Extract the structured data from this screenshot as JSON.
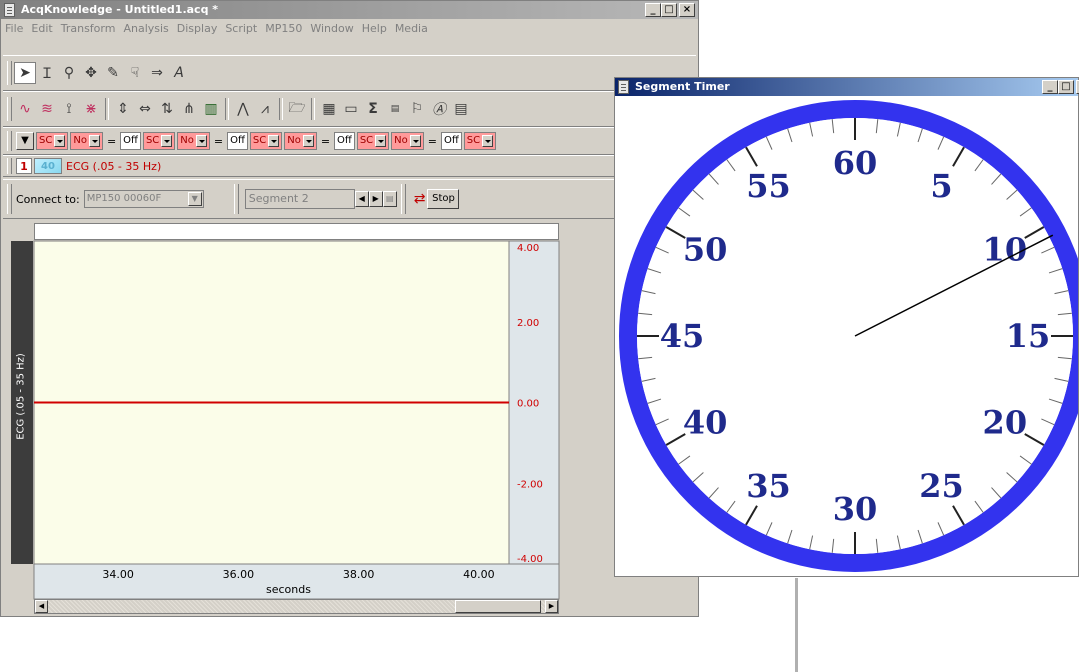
{
  "main_window": {
    "title": "AcqKnowledge - Untitled1.acq *",
    "menu": [
      "File",
      "Edit",
      "Transform",
      "Analysis",
      "Display",
      "Script",
      "MP150",
      "Window",
      "Help",
      "Media"
    ],
    "channel_number": "1",
    "channel_badge": "40",
    "channel_name": "ECG (.05 - 35 Hz)",
    "connect_label": "Connect to:",
    "connect_value": "MP150 00060F",
    "segment_value": "Segment 2",
    "stop_label": "Stop",
    "channel_row": [
      "SC",
      "No",
      "=",
      "Off",
      "SC",
      "No",
      "=",
      "Off",
      "SC",
      "No",
      "=",
      "Off",
      "SC",
      "No",
      "=",
      "Off",
      "SC"
    ],
    "y_axis_label": "ECG (.05 - 35 Hz)",
    "x_axis_title": "seconds"
  },
  "chart_data": {
    "type": "line",
    "xlabel": "seconds",
    "ylabel": "ECG (.05 - 35 Hz)",
    "x_ticks": [
      "34.00",
      "36.00",
      "38.00",
      "40.00"
    ],
    "y_ticks": [
      "4.00",
      "2.00",
      "0.00",
      "-2.00",
      "-4.00"
    ],
    "xlim": [
      32.6,
      40.5
    ],
    "ylim": [
      -4.0,
      4.0
    ],
    "series": [
      {
        "x": [
          32.6,
          40.5
        ],
        "y": [
          0.0,
          0.0
        ]
      }
    ],
    "colors": {
      "line": "#d00000",
      "background": "#fbfde9",
      "axis_text": "#d00000"
    }
  },
  "timer_window": {
    "title": "Segment Timer",
    "dial_labels": [
      "60",
      "5",
      "10",
      "15",
      "20",
      "25",
      "30",
      "35",
      "40",
      "45",
      "50",
      "55"
    ],
    "hand_position_seconds": 10.5,
    "colors": {
      "ring": "#3333ee",
      "numbers": "#1f2a8c"
    }
  }
}
